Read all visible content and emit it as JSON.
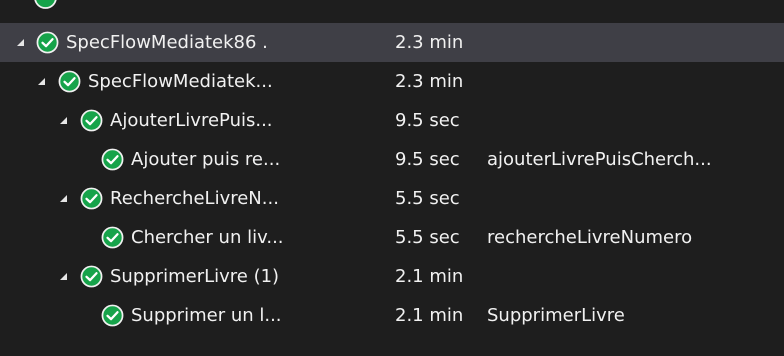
{
  "tree": {
    "rows": [
      {
        "name": "SpecFlowMediatek86 .",
        "duration": "2.3 min",
        "message": "",
        "expandable": true,
        "selected": true,
        "status": "passed"
      },
      {
        "name": "SpecFlowMediatek...",
        "duration": "2.3 min",
        "message": "",
        "expandable": true,
        "selected": false,
        "status": "passed"
      },
      {
        "name": "AjouterLivrePuis...",
        "duration": "9.5 sec",
        "message": "",
        "expandable": true,
        "selected": false,
        "status": "passed"
      },
      {
        "name": "Ajouter puis re...",
        "duration": "9.5 sec",
        "message": "ajouterLivrePuisCherch...",
        "expandable": false,
        "selected": false,
        "status": "passed"
      },
      {
        "name": "RechercheLivreN...",
        "duration": "5.5 sec",
        "message": "",
        "expandable": true,
        "selected": false,
        "status": "passed"
      },
      {
        "name": "Chercher un liv...",
        "duration": "5.5 sec",
        "message": "rechercheLivreNumero",
        "expandable": false,
        "selected": false,
        "status": "passed"
      },
      {
        "name": "SupprimerLivre  (1)",
        "duration": "2.1 min",
        "message": "",
        "expandable": true,
        "selected": false,
        "status": "passed"
      },
      {
        "name": "Supprimer un l...",
        "duration": "2.1 min",
        "message": "SupprimerLivre",
        "expandable": false,
        "selected": false,
        "status": "passed"
      }
    ]
  },
  "colors": {
    "background": "#1e1e1e",
    "selected_row": "#3f3f46",
    "passed": "#16a34a",
    "text": "#f1f1f1"
  },
  "icons": {
    "status": "check-circle-icon",
    "expander": "expanded-triangle-icon"
  }
}
